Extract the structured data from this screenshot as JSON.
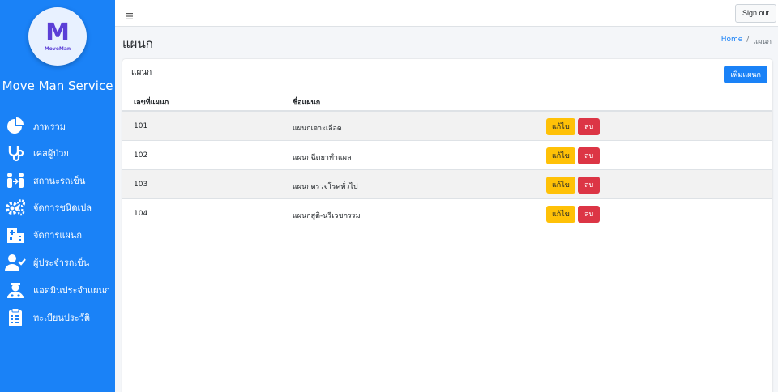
{
  "sidebar": {
    "logo_letter": "M",
    "logo_text": "MoveMan",
    "brand": "Move Man Service",
    "items": [
      {
        "label": "ภาพรวม",
        "icon": "pie-chart-icon"
      },
      {
        "label": "เคสผู้ป่วย",
        "icon": "stethoscope-icon"
      },
      {
        "label": "สถานะรถเข็น",
        "icon": "people-arrows-icon"
      },
      {
        "label": "จัดการชนิดเปล",
        "icon": "gears-icon"
      },
      {
        "label": "จัดการแผนก",
        "icon": "hospital-building-icon"
      },
      {
        "label": "ผู้ประจำรถเข็น",
        "icon": "user-check-icon"
      },
      {
        "label": "แอดมินประจำแผนก",
        "icon": "user-nurse-icon"
      },
      {
        "label": "ทะเบียนประวัติ",
        "icon": "clipboard-list-icon"
      }
    ]
  },
  "topbar": {
    "menu_icon": "hamburger-icon",
    "signout_label": "Sign out"
  },
  "header": {
    "title": "แผนก",
    "breadcrumb": {
      "home": "Home",
      "separator": "/",
      "current": "แผนก"
    }
  },
  "card": {
    "title": "แผนก",
    "add_button": "เพิ่มแผนก",
    "columns": [
      "เลขที่แผนก",
      "ชื่อแผนก"
    ],
    "rows": [
      {
        "no": "101",
        "name": "แผนกเจาะเลือด",
        "edit": "แก้ไข",
        "delete": "ลบ"
      },
      {
        "no": "102",
        "name": "แผนกฉีดยาทำแผล",
        "edit": "แก้ไข",
        "delete": "ลบ"
      },
      {
        "no": "103",
        "name": "แผนกตรวจโรคทั่วไป",
        "edit": "แก้ไข",
        "delete": "ลบ"
      },
      {
        "no": "104",
        "name": "แผนกสูติ-นรีเวชกรรม",
        "edit": "แก้ไข",
        "delete": "ลบ"
      }
    ]
  },
  "colors": {
    "sidebar": "#1a82f7",
    "primary": "#1a82f7",
    "warning": "#ffc107",
    "danger": "#dc3545"
  }
}
